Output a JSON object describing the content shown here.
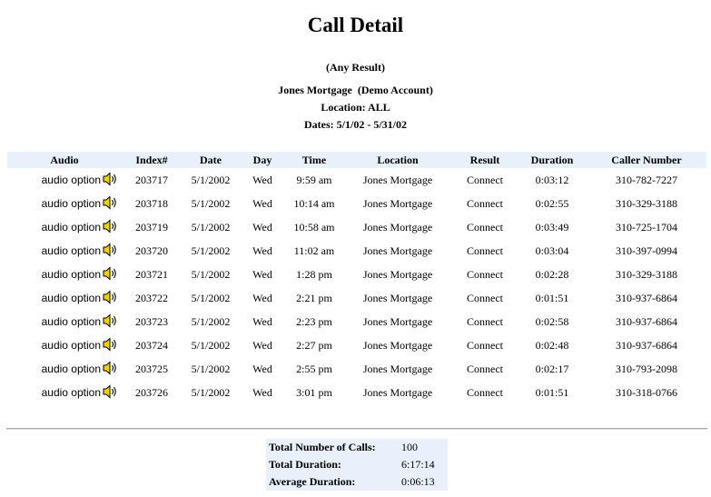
{
  "report": {
    "title": "Call Detail",
    "result_filter": "(Any Result)",
    "account": "Jones Mortgage  (Demo Account)",
    "location": "Location: ALL",
    "dates": "Dates: 5/1/02 - 5/31/02"
  },
  "table": {
    "headers": [
      "Audio",
      "Index#",
      "Date",
      "Day",
      "Time",
      "Location",
      "Result",
      "Duration",
      "Caller Number"
    ],
    "audio_label": "audio option",
    "audio_icon": "speaker-icon",
    "rows": [
      {
        "index": "203717",
        "date": "5/1/2002",
        "day": "Wed",
        "time": "9:59 am",
        "location": "Jones Mortgage",
        "result": "Connect",
        "duration": "0:03:12",
        "caller": "310-782-7227"
      },
      {
        "index": "203718",
        "date": "5/1/2002",
        "day": "Wed",
        "time": "10:14 am",
        "location": "Jones Mortgage",
        "result": "Connect",
        "duration": "0:02:55",
        "caller": "310-329-3188"
      },
      {
        "index": "203719",
        "date": "5/1/2002",
        "day": "Wed",
        "time": "10:58 am",
        "location": "Jones Mortgage",
        "result": "Connect",
        "duration": "0:03:49",
        "caller": "310-725-1704"
      },
      {
        "index": "203720",
        "date": "5/1/2002",
        "day": "Wed",
        "time": "11:02 am",
        "location": "Jones Mortgage",
        "result": "Connect",
        "duration": "0:03:04",
        "caller": "310-397-0994"
      },
      {
        "index": "203721",
        "date": "5/1/2002",
        "day": "Wed",
        "time": "1:28 pm",
        "location": "Jones Mortgage",
        "result": "Connect",
        "duration": "0:02:28",
        "caller": "310-329-3188"
      },
      {
        "index": "203722",
        "date": "5/1/2002",
        "day": "Wed",
        "time": "2:21 pm",
        "location": "Jones Mortgage",
        "result": "Connect",
        "duration": "0:01:51",
        "caller": "310-937-6864"
      },
      {
        "index": "203723",
        "date": "5/1/2002",
        "day": "Wed",
        "time": "2:23 pm",
        "location": "Jones Mortgage",
        "result": "Connect",
        "duration": "0:02:58",
        "caller": "310-937-6864"
      },
      {
        "index": "203724",
        "date": "5/1/2002",
        "day": "Wed",
        "time": "2:27 pm",
        "location": "Jones Mortgage",
        "result": "Connect",
        "duration": "0:02:48",
        "caller": "310-937-6864"
      },
      {
        "index": "203725",
        "date": "5/1/2002",
        "day": "Wed",
        "time": "2:55 pm",
        "location": "Jones Mortgage",
        "result": "Connect",
        "duration": "0:02:17",
        "caller": "310-793-2098"
      },
      {
        "index": "203726",
        "date": "5/1/2002",
        "day": "Wed",
        "time": "3:01 pm",
        "location": "Jones Mortgage",
        "result": "Connect",
        "duration": "0:01:51",
        "caller": "310-318-0766"
      }
    ]
  },
  "totals": {
    "calls_label": "Total Number of Calls:",
    "calls_value": "100",
    "duration_label": "Total Duration:",
    "duration_value": "6:17:14",
    "average_label": "Average Duration:",
    "average_value": "0:06:13"
  },
  "colors": {
    "header_bg": "#e8f1fb",
    "totals_bg": "#e8f1fb"
  }
}
